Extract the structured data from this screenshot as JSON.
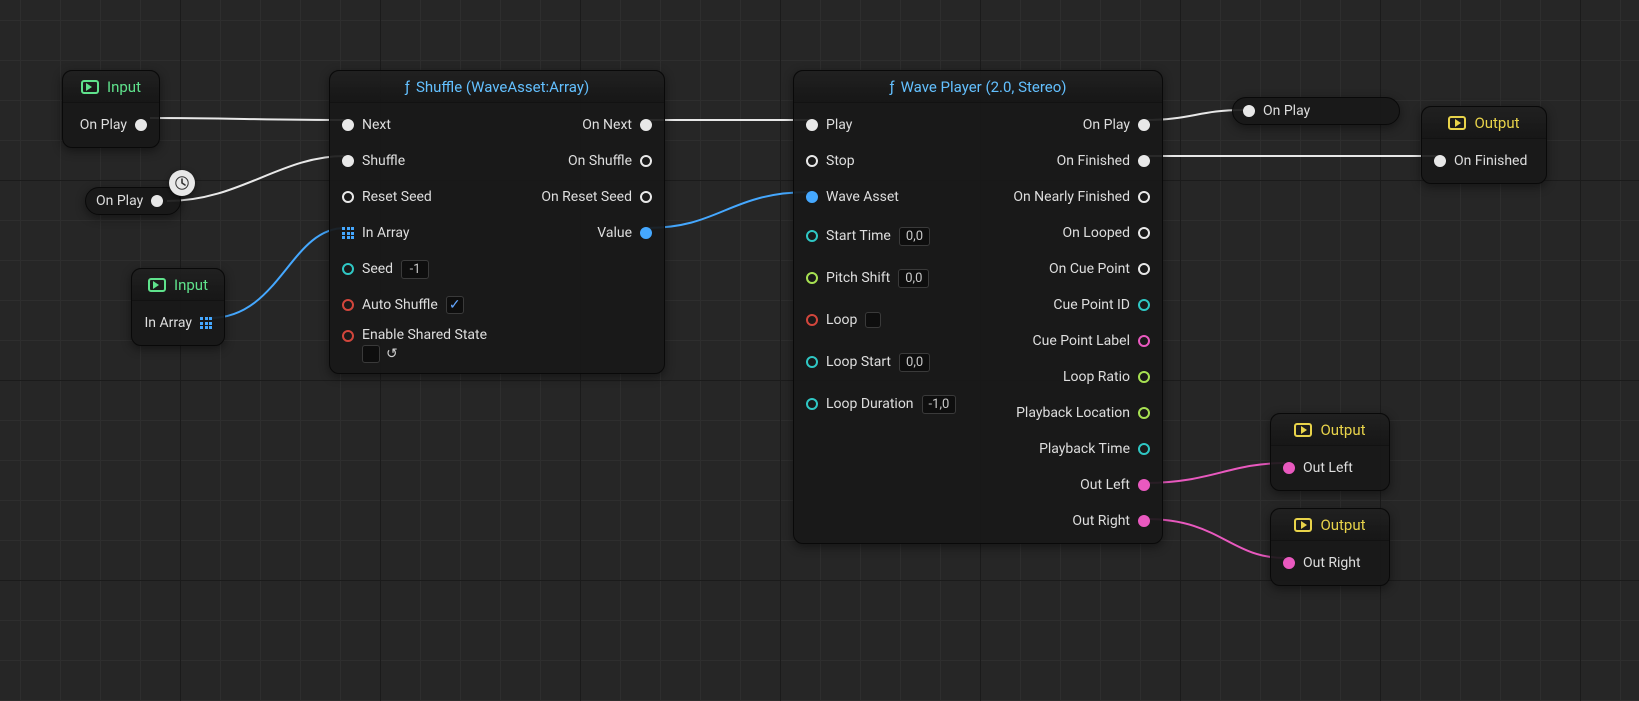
{
  "colors": {
    "exec": "#e8e8e8",
    "audio": "#e959bf",
    "asset": "#45a8ff"
  },
  "nodes": {
    "input1": {
      "title": "Input",
      "pins": {
        "on_play": "On Play"
      }
    },
    "reroute_onplay": {
      "label": "On Play"
    },
    "input2": {
      "title": "Input",
      "pins": {
        "in_array": "In Array"
      }
    },
    "shuffle": {
      "title": "Shuffle (WaveAsset:Array)",
      "inputs": {
        "next": "Next",
        "shuffle": "Shuffle",
        "reset_seed": "Reset Seed",
        "in_array": "In Array",
        "seed": "Seed",
        "seed_value": "-1",
        "auto_shuffle": "Auto Shuffle",
        "auto_shuffle_checked": true,
        "enable_shared_state": "Enable Shared State"
      },
      "outputs": {
        "on_next": "On Next",
        "on_shuffle": "On Shuffle",
        "on_reset_seed": "On Reset Seed",
        "value": "Value"
      }
    },
    "waveplayer": {
      "title": "Wave Player (2.0, Stereo)",
      "inputs": {
        "play": "Play",
        "stop": "Stop",
        "wave_asset": "Wave Asset",
        "start_time": "Start Time",
        "start_time_value": "0,0",
        "pitch_shift": "Pitch Shift",
        "pitch_shift_value": "0,0",
        "loop": "Loop",
        "loop_start": "Loop Start",
        "loop_start_value": "0,0",
        "loop_duration": "Loop Duration",
        "loop_duration_value": "-1,0"
      },
      "outputs": {
        "on_play": "On Play",
        "on_finished": "On Finished",
        "on_nearly_finished": "On Nearly Finished",
        "on_looped": "On Looped",
        "on_cue_point": "On Cue Point",
        "cue_point_id": "Cue Point ID",
        "cue_point_label": "Cue Point Label",
        "loop_ratio": "Loop Ratio",
        "playback_location": "Playback Location",
        "playback_time": "Playback Time",
        "out_left": "Out Left",
        "out_right": "Out Right"
      }
    },
    "reroute_onplay2": {
      "label": "On Play"
    },
    "output_main": {
      "title": "Output",
      "pins": {
        "on_finished": "On Finished"
      }
    },
    "output_left": {
      "title": "Output",
      "pins": {
        "out_left": "Out Left"
      }
    },
    "output_right": {
      "title": "Output",
      "pins": {
        "out_right": "Out Right"
      }
    }
  }
}
